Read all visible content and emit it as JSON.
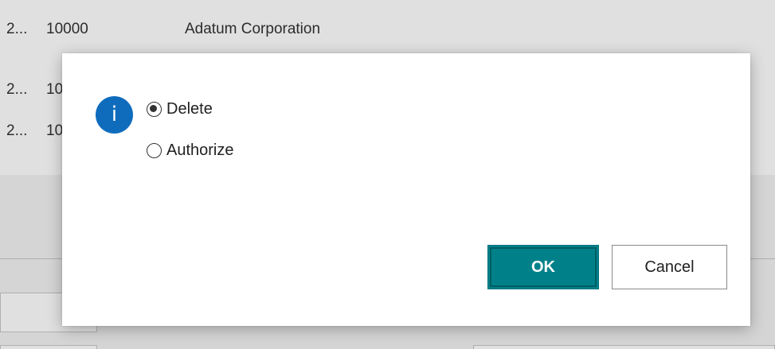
{
  "background_list": {
    "rows": [
      {
        "col1": "2...",
        "col2": "10000",
        "col3": "Adatum Corporation"
      },
      {
        "col1": "2...",
        "col2": "10",
        "col3": ""
      },
      {
        "col1": "2...",
        "col2": "10",
        "col3": ""
      }
    ]
  },
  "dialog": {
    "icon": "info-icon",
    "icon_glyph": "i",
    "options": [
      {
        "label": "Delete",
        "selected": true
      },
      {
        "label": "Authorize",
        "selected": false
      }
    ],
    "ok_label": "OK",
    "cancel_label": "Cancel"
  },
  "colors": {
    "primary_button": "#00818a",
    "info_icon": "#0f6cbd"
  }
}
